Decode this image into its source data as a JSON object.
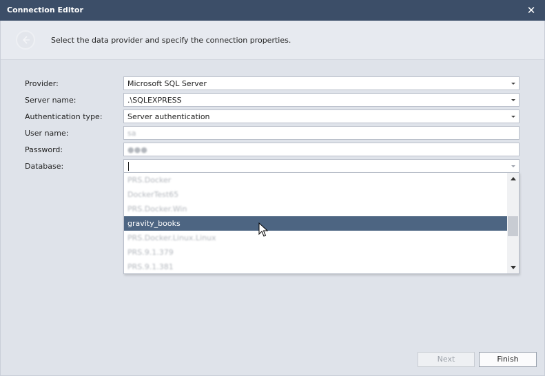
{
  "window": {
    "title": "Connection Editor",
    "close_glyph": "✕"
  },
  "header": {
    "description": "Select the data provider and specify the connection properties."
  },
  "form": {
    "provider": {
      "label": "Provider:",
      "value": "Microsoft SQL Server"
    },
    "server_name": {
      "label": "Server name:",
      "value": ".\\SQLEXPRESS"
    },
    "auth_type": {
      "label": "Authentication type:",
      "value": "Server authentication"
    },
    "user_name": {
      "label": "User name:",
      "value": "sa"
    },
    "password": {
      "label": "Password:",
      "value": "●●●"
    },
    "database": {
      "label": "Database:",
      "value": ""
    }
  },
  "database_dropdown": {
    "items": [
      {
        "label": "PRS.Docker",
        "blurred": true
      },
      {
        "label": "DockerTest65",
        "blurred": true
      },
      {
        "label": "PRS.Docker.Win",
        "blurred": true
      },
      {
        "label": "gravity_books",
        "blurred": false,
        "selected": true
      },
      {
        "label": "PRS.Docker.Linux.Linux",
        "blurred": true
      },
      {
        "label": "PRS.9.1.379",
        "blurred": true
      },
      {
        "label": "PRS.9.1.381",
        "blurred": true
      }
    ]
  },
  "footer": {
    "next_label": "Next",
    "finish_label": "Finish"
  },
  "colors": {
    "titlebar": "#3c4e68",
    "selected_item": "#4d6582",
    "background": "#dfe3ea"
  }
}
